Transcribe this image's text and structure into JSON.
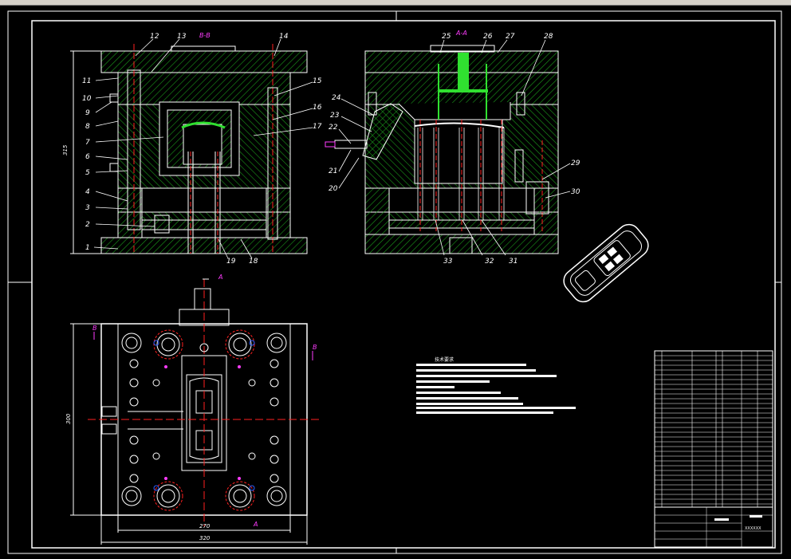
{
  "sections": {
    "bb_title": "B-B",
    "aa_title": "A-A",
    "arrow_a": "A",
    "arrow_b": "B"
  },
  "left_view_labels": [
    "1",
    "2",
    "3",
    "4",
    "5",
    "6",
    "7",
    "8",
    "9",
    "10",
    "11",
    "12",
    "13",
    "14",
    "15",
    "16",
    "17",
    "18",
    "19"
  ],
  "right_view_labels": [
    "20",
    "21",
    "22",
    "23",
    "24",
    "25",
    "26",
    "27",
    "28",
    "29",
    "30",
    "31",
    "32",
    "33"
  ],
  "dimensions": {
    "height_left": "315",
    "height_plan": "300",
    "width_inner": "270",
    "width_outer": "320"
  },
  "notes": {
    "title": "技术要求"
  },
  "title_block": {
    "drawing_no": "XXXXXX"
  },
  "colors": {
    "background": "#000000",
    "outline": "#ffffff",
    "hatch": "#1a9a1a",
    "centerline": "#ff2020",
    "section_label": "#ff3cff",
    "highlight": "#30e030",
    "accent_blue": "#3060ff"
  }
}
